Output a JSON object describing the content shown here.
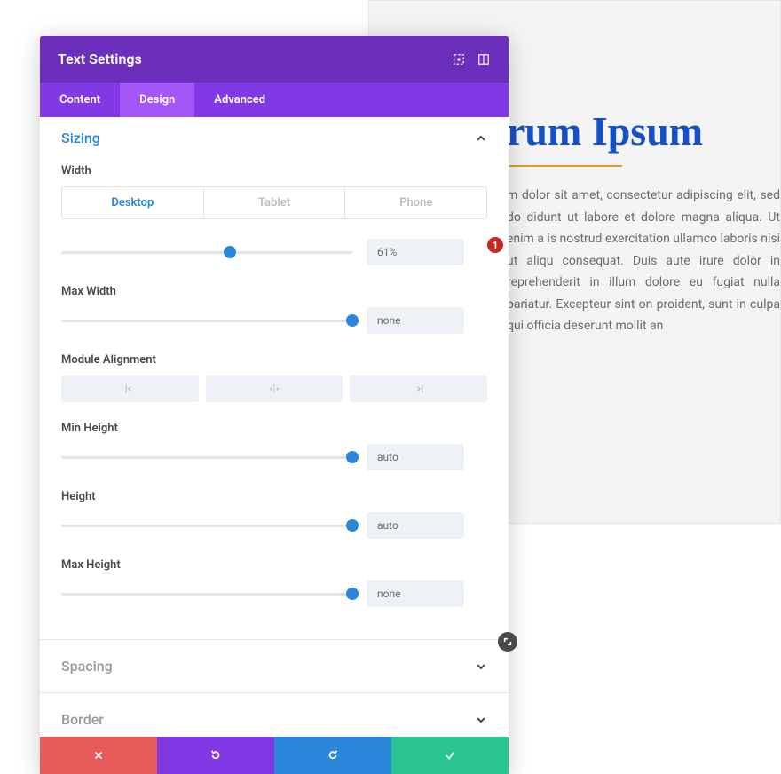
{
  "page": {
    "title": "rum Ipsum",
    "body": "m dolor sit amet, consectetur adipiscing elit, sed do didunt ut labore et dolore magna aliqua. Ut enim a is nostrud exercitation ullamco laboris nisi ut aliqu consequat. Duis aute irure dolor in reprehenderit in illum dolore eu fugiat nulla pariatur. Excepteur sint on proident, sunt in culpa qui officia deserunt mollit an"
  },
  "panel": {
    "title": "Text Settings",
    "tabs": {
      "content": "Content",
      "design": "Design",
      "advanced": "Advanced"
    },
    "sections": {
      "sizing": "Sizing",
      "spacing": "Spacing",
      "border": "Border"
    },
    "sizing": {
      "width_label": "Width",
      "devices": {
        "desktop": "Desktop",
        "tablet": "Tablet",
        "phone": "Phone"
      },
      "width_value": "61%",
      "width_slider_percent": 58,
      "max_width_label": "Max Width",
      "max_width_value": "none",
      "module_alignment_label": "Module Alignment",
      "min_height_label": "Min Height",
      "min_height_value": "auto",
      "height_label": "Height",
      "height_value": "auto",
      "max_height_label": "Max Height",
      "max_height_value": "none",
      "badge": "1"
    }
  }
}
